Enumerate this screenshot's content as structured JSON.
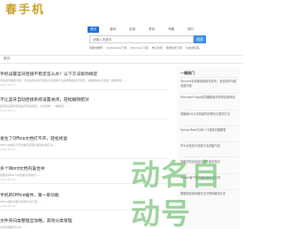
{
  "logo": {
    "chars": [
      "春",
      "手",
      "机"
    ]
  },
  "nav": {
    "tabs": [
      "首页",
      "游戏",
      "应用",
      "资讯",
      "专题",
      "排行"
    ],
    "active_index": 0
  },
  "search": {
    "placeholder": "请输入关键词",
    "button": "搜索"
  },
  "hot_links": [
    "赞助商推荐",
    "mytokenios下载",
    "discovery下载",
    "电子合同",
    "免费在线下载",
    "qq在线实名"
  ],
  "breadcrumb": "首页",
  "articles": [
    {
      "title": "手机设置蓝牙连接不稳定怎么办？以下方法帮你搞定",
      "desc": "手机蓝牙断连卡顿，手机设置中蓝牙连接方式选择不当会导致连接不稳定，请根据本文方法逐一排查修复......",
      "meta": "2024-05-12"
    },
    {
      "title": "不让蓝牙自动连接系统设置关闭，轻松解除配对",
      "desc": "如何在设置中取消蓝牙自动连接，方法简单，一看就懂......",
      "meta": "2024-05-11"
    },
    {
      "title": "发生了Office文档打不开，轻松修复",
      "desc": "Office文档打不开的常见原因与解决方案汇总......",
      "meta": "2024-05-10"
    },
    {
      "title": "多个Word文档内容合并",
      "desc": "批量合并Word文档的实用技巧......",
      "meta": "2024-05-09"
    },
    {
      "title": "手机的Office插件，第一章功能",
      "desc": "Office插件功能与使用方法介绍......",
      "meta": "2024-05-08"
    },
    {
      "title": "文件夹归类整理全攻略，高效分类管理",
      "desc": "文件管理技巧分享......",
      "meta": "2024-05-07"
    }
  ],
  "sidebar": {
    "title": "一周热门",
    "items": [
      "Tencent手机管家新版本发布，安全防护功能全面升级",
      "Microsoft Edge浏览器新版本带来全新体验",
      "电脑版QQ与手机版同步聊天记录的方法",
      "Spring Boot与JDK 21相关问题解答",
      "华为手机双卡设置方法详细介绍",
      "电脑开机自动启动软件如何关闭",
      "Steam客户端下载加速方法分享",
      "数据线连接电脑无法识别的解决办法"
    ]
  },
  "watermark": "动名自动号"
}
